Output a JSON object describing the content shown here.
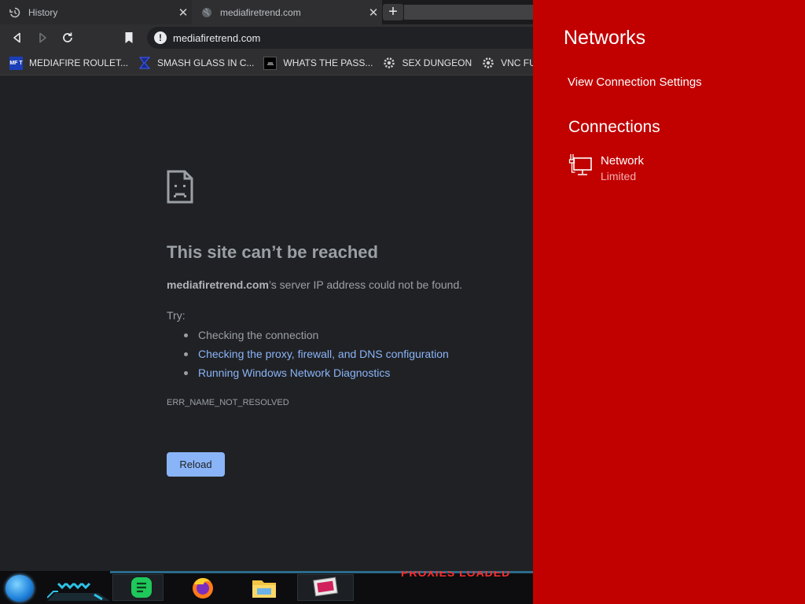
{
  "browser": {
    "tabs": [
      {
        "title": "History",
        "icon": "history-icon"
      },
      {
        "title": "mediafiretrend.com",
        "icon": "globe-icon"
      }
    ],
    "url": "mediafiretrend.com",
    "bookmarks": [
      {
        "label": "MEDIAFIRE ROULET...",
        "icon": "mft-icon",
        "icon_text": "MF T"
      },
      {
        "label": "SMASH GLASS IN C...",
        "icon": "sigma-icon"
      },
      {
        "label": "WHATS THE PASS...",
        "icon": "dark-square-icon"
      },
      {
        "label": "SEX DUNGEON",
        "icon": "gear-icon"
      },
      {
        "label": "VNC FUN",
        "icon": "gear-icon"
      }
    ]
  },
  "error": {
    "title": "This site can’t be reached",
    "domain": "mediafiretrend.com",
    "desc_rest": "’s server IP address could not be found.",
    "try_label": "Try:",
    "suggestions": [
      {
        "text": "Checking the connection",
        "link": false
      },
      {
        "text": "Checking the proxy, firewall, and DNS configuration",
        "link": true
      },
      {
        "text": "Running Windows Network Diagnostics",
        "link": true
      }
    ],
    "code": "ERR_NAME_NOT_RESOLVED",
    "reload_label": "Reload"
  },
  "taskbar": {
    "ticker": "PROXIES LOADED",
    "apps": [
      "start-orb",
      "notes-app",
      "firefox-app",
      "file-explorer-app",
      "media-app"
    ]
  },
  "networks": {
    "title": "Networks",
    "settings_link": "View Connection Settings",
    "connections_heading": "Connections",
    "items": [
      {
        "name": "Network",
        "status": "Limited"
      }
    ]
  },
  "colors": {
    "flyout_bg": "#c10000",
    "link": "#8ab4f8",
    "page_bg": "#202124"
  }
}
